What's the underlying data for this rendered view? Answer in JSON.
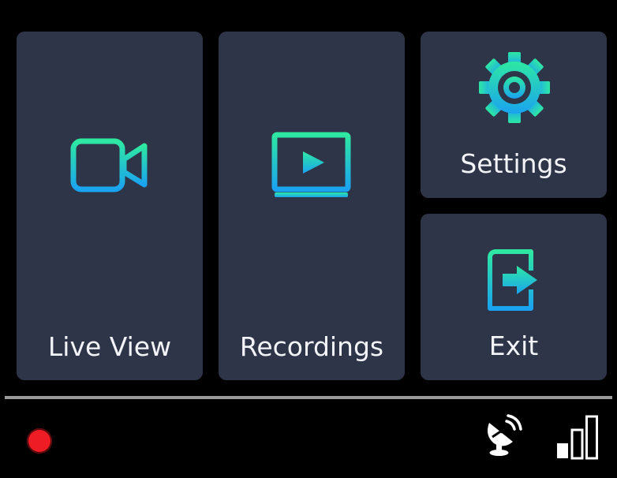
{
  "tiles": {
    "live_view": {
      "label": "Live View",
      "icon": "video-camera-icon"
    },
    "recordings": {
      "label": "Recordings",
      "icon": "play-video-icon"
    },
    "settings": {
      "label": "Settings",
      "icon": "gear-icon"
    },
    "exit": {
      "label": "Exit",
      "icon": "exit-door-icon"
    }
  },
  "status_bar": {
    "recording_indicator": {
      "icon": "record-dot-icon",
      "color": "#ee1c24"
    },
    "satellite": {
      "icon": "satellite-dish-icon"
    },
    "signal": {
      "icon": "signal-strength-icon",
      "level": 0.33,
      "bars_total": 3,
      "bars_filled": 1
    }
  },
  "colors": {
    "tile_background": "#2e3548",
    "icon_gradient_start": "#2ee8a2",
    "icon_gradient_end": "#1aa3f0",
    "screen_background": "#000000"
  }
}
